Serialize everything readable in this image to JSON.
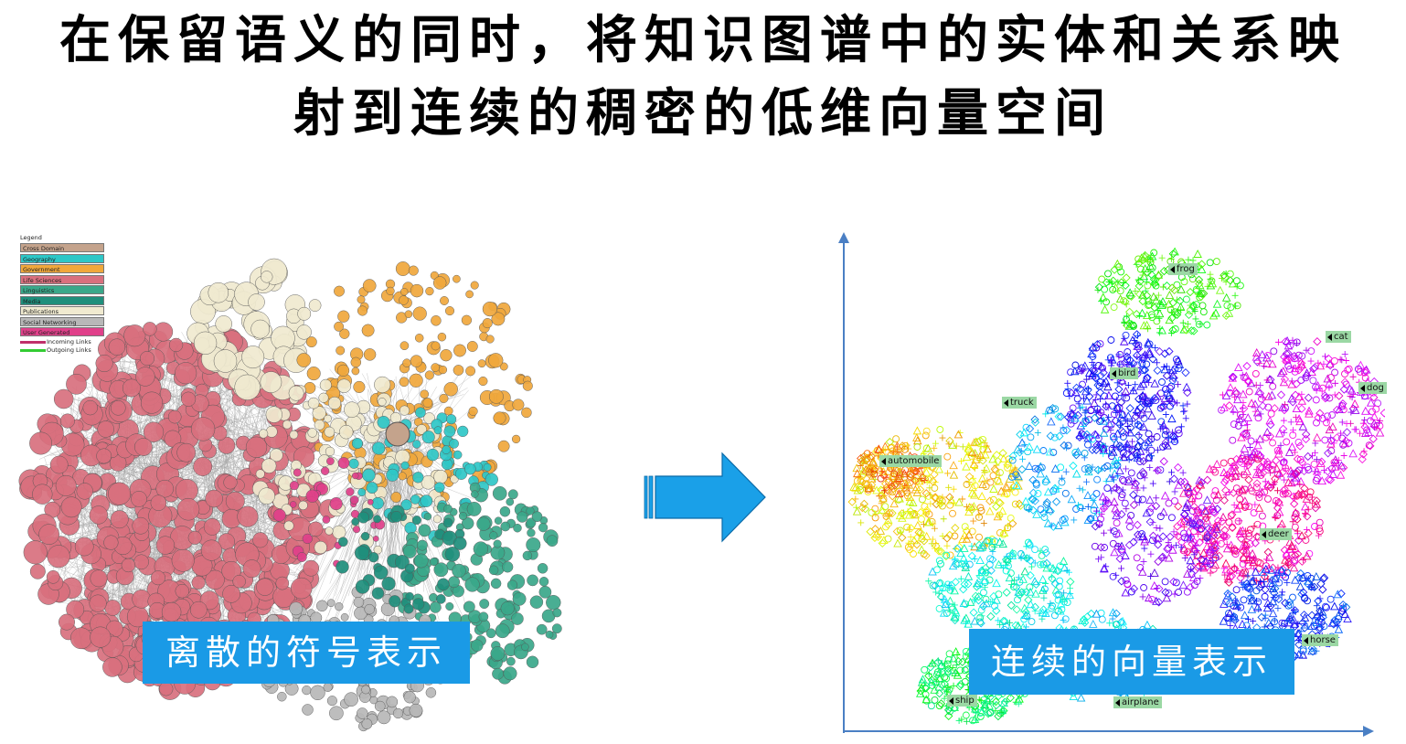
{
  "title": {
    "line1": "在保留语义的同时，将知识图谱中的实体和关系映",
    "line2": "射到连续的稠密的低维向量空间"
  },
  "legend": {
    "title": "Legend",
    "items": [
      {
        "label": "Cross Domain",
        "color": "#c4a38c"
      },
      {
        "label": "Geography",
        "color": "#2ec7c7"
      },
      {
        "label": "Government",
        "color": "#f0a83c"
      },
      {
        "label": "Life Sciences",
        "color": "#d9707e"
      },
      {
        "label": "Linguistics",
        "color": "#3aa88a"
      },
      {
        "label": "Media",
        "color": "#1f8f7c"
      },
      {
        "label": "Publications",
        "color": "#f0ead0"
      },
      {
        "label": "Social Networking",
        "color": "#b8b8b8"
      },
      {
        "label": "User Generated",
        "color": "#e0408a"
      }
    ],
    "links": [
      {
        "label": "Incoming Links",
        "color": "#c0306a"
      },
      {
        "label": "Outgoing Links",
        "color": "#33cc33"
      }
    ]
  },
  "captions": {
    "left": "离散的符号表示",
    "right": "连续的向量表示"
  },
  "embedding_labels": [
    "frog",
    "cat",
    "bird",
    "dog",
    "truck",
    "automobile",
    "deer",
    "horse",
    "ship",
    "airplane"
  ],
  "colors": {
    "caption_bg": "#1a9ae6",
    "arrow": "#1aa0e8",
    "axis": "#4a7fc4",
    "label_bg": "#9bd8a4"
  }
}
